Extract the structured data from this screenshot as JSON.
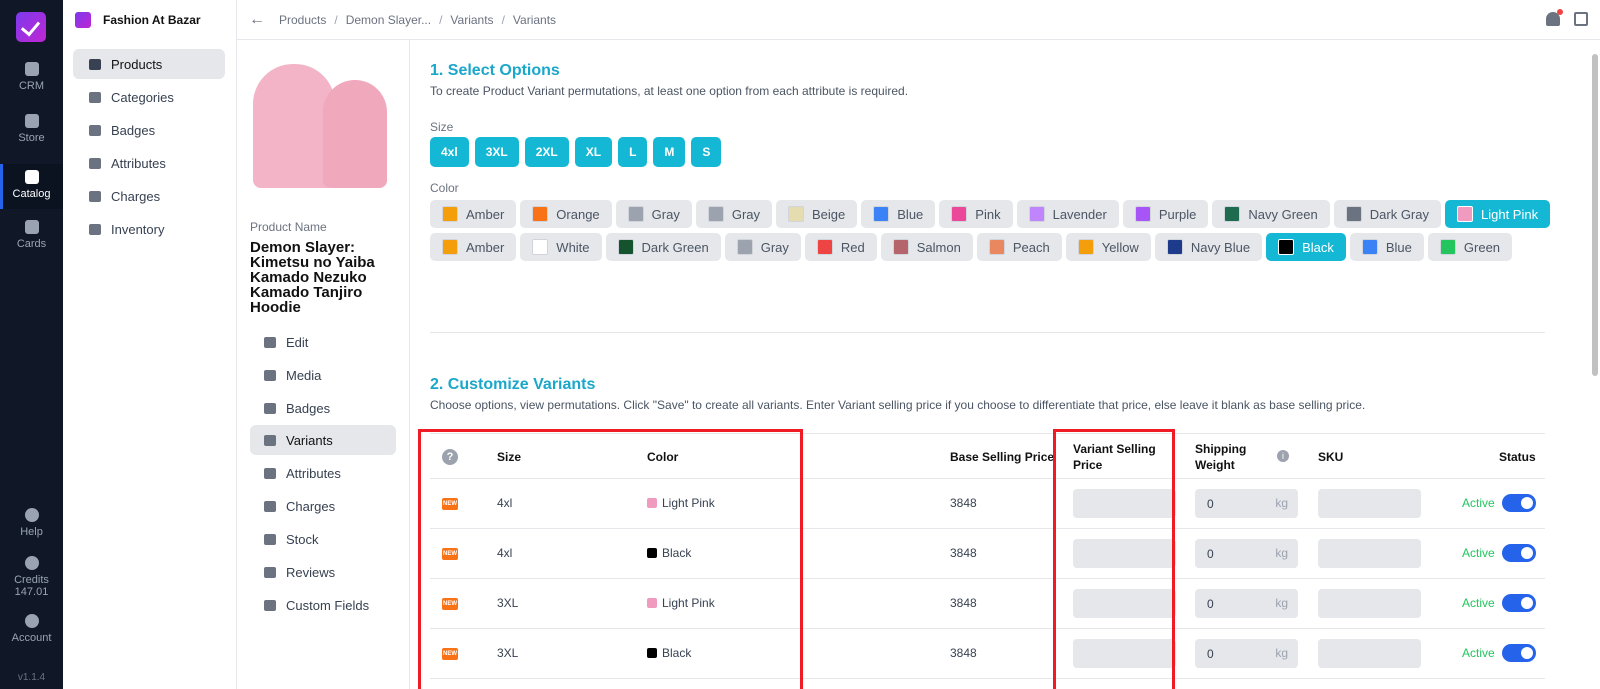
{
  "rail": {
    "items": [
      {
        "label": "CRM"
      },
      {
        "label": "Store"
      },
      {
        "label": "Catalog"
      },
      {
        "label": "Cards"
      },
      {
        "label": "Help"
      },
      {
        "label": "Credits"
      },
      {
        "label": "Account"
      }
    ],
    "credits_value": "147.01",
    "version": "v1.1.4"
  },
  "sidebar": {
    "brand": "Fashion At Bazar",
    "items": [
      {
        "label": "Products",
        "icon": "product-icon"
      },
      {
        "label": "Categories",
        "icon": "categories-icon"
      },
      {
        "label": "Badges",
        "icon": "tag-icon"
      },
      {
        "label": "Attributes",
        "icon": "attributes-icon"
      },
      {
        "label": "Charges",
        "icon": "charges-icon"
      },
      {
        "label": "Inventory",
        "icon": "warehouse-icon"
      }
    ]
  },
  "breadcrumb": [
    "Products",
    "Demon Slayer...",
    "Variants",
    "Variants"
  ],
  "product": {
    "name_label": "Product Name",
    "name": "Demon Slayer: Kimetsu no Yaiba Kamado Nezuko Kamado Tanjiro Hoodie",
    "menu": [
      "Edit",
      "Media",
      "Badges",
      "Variants",
      "Attributes",
      "Charges",
      "Stock",
      "Reviews",
      "Custom Fields"
    ]
  },
  "options": {
    "title": "1. Select Options",
    "subtitle": "To create Product Variant permutations, at least one option from each attribute is required.",
    "size_label": "Size",
    "sizes": [
      "4xl",
      "3XL",
      "2XL",
      "XL",
      "L",
      "M",
      "S"
    ],
    "color_label": "Color",
    "colors": [
      {
        "name": "Amber",
        "hex": "#f59e0b",
        "selected": false
      },
      {
        "name": "Orange",
        "hex": "#f97316",
        "selected": false
      },
      {
        "name": "Gray",
        "hex": "#9ca3af",
        "selected": false
      },
      {
        "name": "Gray",
        "hex": "#9ca3af",
        "selected": false
      },
      {
        "name": "Beige",
        "hex": "#e5dcb0",
        "selected": false
      },
      {
        "name": "Blue",
        "hex": "#3b82f6",
        "selected": false
      },
      {
        "name": "Pink",
        "hex": "#ec4899",
        "selected": false
      },
      {
        "name": "Lavender",
        "hex": "#c084fc",
        "selected": false
      },
      {
        "name": "Purple",
        "hex": "#a855f7",
        "selected": false
      },
      {
        "name": "Navy Green",
        "hex": "#1e6b4f",
        "selected": false
      },
      {
        "name": "Dark Gray",
        "hex": "#6b7280",
        "selected": false
      },
      {
        "name": "Light Pink",
        "hex": "#f09ac0",
        "selected": true
      },
      {
        "name": "Amber",
        "hex": "#f59e0b",
        "selected": false
      },
      {
        "name": "White",
        "hex": "#ffffff",
        "selected": false
      },
      {
        "name": "Dark Green",
        "hex": "#14532d",
        "selected": false
      },
      {
        "name": "Gray",
        "hex": "#9ca3af",
        "selected": false
      },
      {
        "name": "Red",
        "hex": "#ef4444",
        "selected": false
      },
      {
        "name": "Salmon",
        "hex": "#b5646b",
        "selected": false
      },
      {
        "name": "Peach",
        "hex": "#e9875f",
        "selected": false
      },
      {
        "name": "Yellow",
        "hex": "#f59e0b",
        "selected": false
      },
      {
        "name": "Navy Blue",
        "hex": "#1e3a8a",
        "selected": false
      },
      {
        "name": "Black",
        "hex": "#000000",
        "selected": true
      },
      {
        "name": "Blue",
        "hex": "#3b82f6",
        "selected": false
      },
      {
        "name": "Green",
        "hex": "#22c55e",
        "selected": false
      }
    ]
  },
  "variants": {
    "title": "2. Customize Variants",
    "subtitle": "Choose options, view permutations. Click \"Save\" to create all variants. Enter Variant selling price if you choose to differentiate that price, else leave it blank as base selling price.",
    "headers": {
      "size": "Size",
      "color": "Color",
      "base_price": "Base Selling Price",
      "variant_price": "Variant Selling Price",
      "shipping": "Shipping Weight",
      "sku": "SKU",
      "status": "Status"
    },
    "rows": [
      {
        "size": "4xl",
        "color": "Light Pink",
        "color_hex": "#f09ac0",
        "base_price": "3848",
        "weight": "0",
        "unit": "kg",
        "status": "Active"
      },
      {
        "size": "4xl",
        "color": "Black",
        "color_hex": "#000000",
        "base_price": "3848",
        "weight": "0",
        "unit": "kg",
        "status": "Active"
      },
      {
        "size": "3XL",
        "color": "Light Pink",
        "color_hex": "#f09ac0",
        "base_price": "3848",
        "weight": "0",
        "unit": "kg",
        "status": "Active"
      },
      {
        "size": "3XL",
        "color": "Black",
        "color_hex": "#000000",
        "base_price": "3848",
        "weight": "0",
        "unit": "kg",
        "status": "Active"
      }
    ],
    "new_badge": "NEW"
  }
}
